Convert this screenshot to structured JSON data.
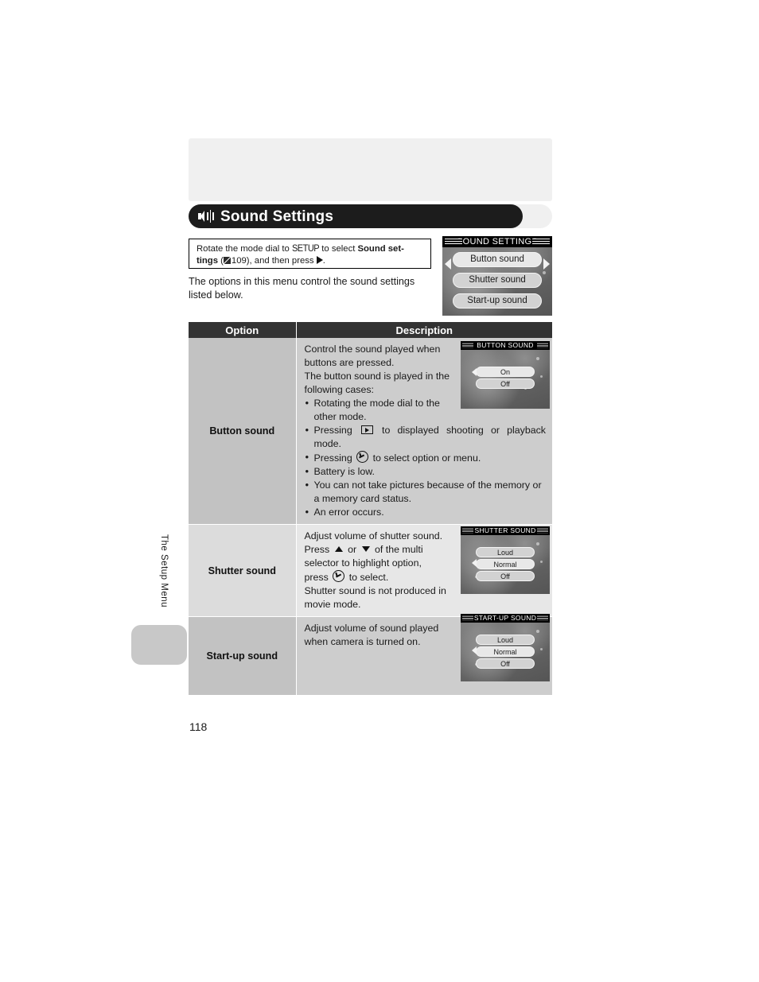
{
  "page": {
    "number": "118",
    "side_tab_label": "The Setup Menu"
  },
  "header": {
    "title": "Sound Settings",
    "icon": "speaker-sound-icon"
  },
  "instruction": {
    "line1_a": "Rotate the mode dial to ",
    "setup_glyph": "SETUP",
    "line1_b": " to select ",
    "bold1": "Sound set-",
    "bold2": "tings",
    "ref_open": " (",
    "book_icon": "book-reference-icon",
    "ref_page": "109",
    "ref_close": "), and then press ",
    "arrow_icon": "right-arrow-icon",
    "period": "."
  },
  "intro": "The options in this menu control the sound settings listed below.",
  "lcd_main": {
    "title": "SOUND SETTINGS",
    "items": [
      {
        "label": "Button sound",
        "selected": true
      },
      {
        "label": "Shutter sound",
        "selected": false
      },
      {
        "label": "Start-up sound",
        "selected": false
      }
    ],
    "arrow_left": "left-arrow-icon",
    "arrow_right": "right-arrow-icon"
  },
  "table": {
    "headers": {
      "option": "Option",
      "description": "Description"
    },
    "rows": [
      {
        "option": "Button sound",
        "desc_p1": "Control the sound played when buttons are pressed.",
        "desc_p2": "The button sound is played in the following cases:",
        "bullets": [
          {
            "pre": "Rotating the mode dial to the other mode.",
            "icon": null,
            "post": ""
          },
          {
            "pre": "Pressing ",
            "icon": "playback-icon",
            "post": " to displayed shooting or playback mode."
          },
          {
            "pre": "Pressing ",
            "icon": "ok-button-icon",
            "post": " to select option or menu."
          },
          {
            "pre": "Battery is low.",
            "icon": null,
            "post": ""
          },
          {
            "pre": "You can not take pictures because of the memory or a memory card status.",
            "icon": null,
            "post": ""
          },
          {
            "pre": "An error occurs.",
            "icon": null,
            "post": ""
          }
        ],
        "lcd": {
          "title": "BUTTON SOUND",
          "items": [
            {
              "label": "On",
              "selected": true
            },
            {
              "label": "Off",
              "selected": false
            }
          ],
          "arrow_left": "left-arrow-icon"
        }
      },
      {
        "option": "Shutter sound",
        "line1": "Adjust volume of shutter sound.",
        "line2_a": "Press ",
        "line2_up": "up-arrow-icon",
        "line2_b": " or ",
        "line2_down": "down-arrow-icon",
        "line2_c": " of the multi",
        "line3": "selector to highlight option,",
        "line4_a": "press ",
        "line4_ok": "ok-button-icon",
        "line4_b": " to select.",
        "line5": "Shutter sound is not produced in movie mode.",
        "lcd": {
          "title": "SHUTTER SOUND",
          "items": [
            {
              "label": "Loud",
              "selected": false
            },
            {
              "label": "Normal",
              "selected": true
            },
            {
              "label": "Off",
              "selected": false
            }
          ],
          "arrow_left": "left-arrow-icon"
        }
      },
      {
        "option": "Start-up sound",
        "line1": "Adjust volume of sound played when camera is turned on.",
        "lcd": {
          "title": "START-UP SOUND",
          "items": [
            {
              "label": "Loud",
              "selected": false
            },
            {
              "label": "Normal",
              "selected": true
            },
            {
              "label": "Off",
              "selected": false
            }
          ],
          "arrow_left": "left-arrow-icon"
        }
      }
    ]
  },
  "colors": {
    "header_bar": "#1c1c1c",
    "table_header": "#333333",
    "row_dark": "#c2c2c2",
    "row_light": "#e7e7e7",
    "panel": "#f0f0f0"
  }
}
